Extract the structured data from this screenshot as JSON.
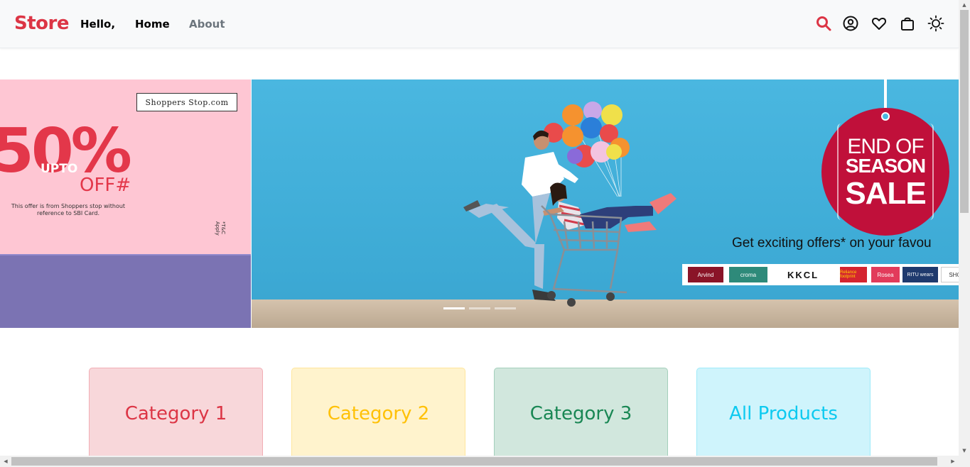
{
  "navbar": {
    "brand": "Store",
    "greeting": "Hello,",
    "links": [
      "Home",
      "About"
    ],
    "icons": [
      "search-icon",
      "user-icon",
      "heart-icon",
      "bag-icon",
      "sun-icon"
    ],
    "brand_color": "#dc3545"
  },
  "carousel": {
    "slide_left": {
      "logo": "Shoppers Stop.com",
      "percent": "50%",
      "upto": "UPTO",
      "off": "OFF#",
      "offer_line1": "This offer is from Shoppers stop without",
      "offer_line2": "reference to SBI Card.",
      "tc": "*T&C Apply"
    },
    "slide_main": {
      "tag_line1": "END OF",
      "tag_line2": "SEASON",
      "tag_line3": "SALE",
      "offers_text": "Get exciting offers* on your favou",
      "brands": [
        "Arvind",
        "croma",
        "KKCL",
        "Reliance footprint",
        "Rosea",
        "RITU wears",
        "SHO"
      ]
    },
    "indicators": 3,
    "active_index": 0
  },
  "categories": [
    "Category 1",
    "Category 2",
    "Category 3",
    "All Products"
  ]
}
